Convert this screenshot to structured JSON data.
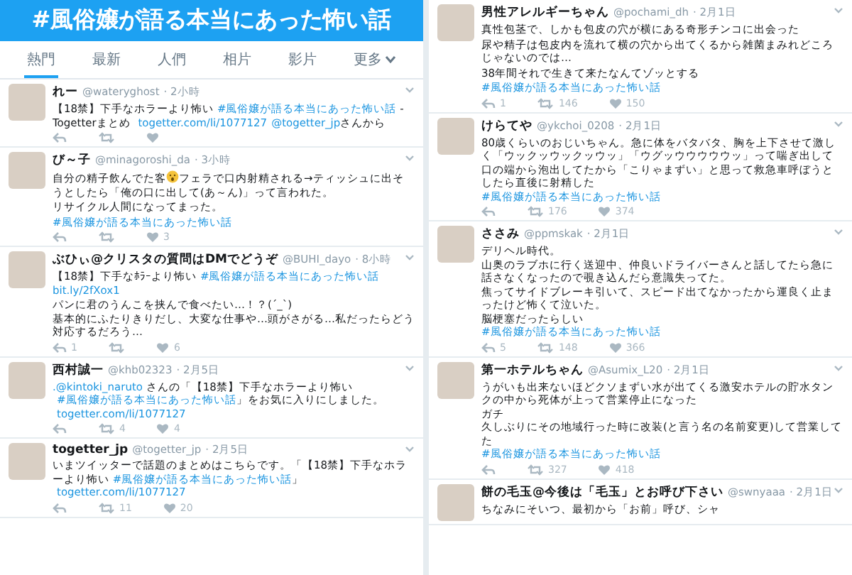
{
  "header": {
    "title": "#風俗嬢が語る本当にあった怖い話"
  },
  "tabs": [
    {
      "label": "熱門",
      "selected": true,
      "kind": "plain"
    },
    {
      "label": "最新",
      "selected": false,
      "kind": "plain"
    },
    {
      "label": "人們",
      "selected": false,
      "kind": "plain"
    },
    {
      "label": "相片",
      "selected": false,
      "kind": "plain"
    },
    {
      "label": "影片",
      "selected": false,
      "kind": "plain"
    },
    {
      "label": "更多",
      "selected": false,
      "kind": "dropdown"
    }
  ],
  "left_column": [
    {
      "name": "れー",
      "handle": "@wateryghost",
      "time": "· 2小時",
      "body": [
        [
          [
            {
              "kind": "text",
              "text": "【18禁】下手なホラーより怖い "
            },
            {
              "kind": "hashtag",
              "text": "#風俗嬢が語る本当にあった怖い話"
            },
            {
              "kind": "text",
              "text": " - Togetterまとめ "
            },
            {
              "kind": "url",
              "text": "togetter.com/li/1077127"
            },
            {
              "kind": "mention",
              "text": "@togetter_jp"
            },
            {
              "kind": "text",
              "text": "さんから"
            }
          ]
        ]
      ],
      "actions": [
        {
          "kind": "reply"
        },
        {
          "kind": "retweet"
        },
        {
          "kind": "like"
        }
      ]
    },
    {
      "name": "び～子",
      "handle": "@minagoroshi_da",
      "time": "· 3小時",
      "body": [
        [
          [
            {
              "kind": "text",
              "text": "自分の精子飲んでた客"
            },
            {
              "kind": "emoji"
            },
            {
              "kind": "text",
              "text": "フェラで口内射精される→ティッシュに出そうとしたら「俺の口に出して(あ～ん)」って言われた。"
            }
          ]
        ],
        [
          [
            {
              "kind": "text",
              "text": "リサイクル人間になってまった。"
            }
          ]
        ],
        [
          [
            {
              "kind": "hashtag",
              "text": "#風俗嬢が語る本当にあった怖い話"
            }
          ]
        ]
      ],
      "actions": [
        {
          "kind": "reply"
        },
        {
          "kind": "retweet"
        },
        {
          "kind": "like",
          "count": "3"
        }
      ]
    },
    {
      "name": "ぶひぃ@クリスタの質問はDMでどうぞ",
      "handle": "@BUHI_dayo",
      "time": "· 8小時",
      "body": [
        [
          [
            {
              "kind": "text",
              "text": "【18禁】下手なﾎﾗｰより怖い "
            },
            {
              "kind": "hashtag",
              "text": "#風俗嬢が語る本当にあった怖い話"
            }
          ],
          [
            {
              "kind": "url",
              "text": "bit.ly/2fXox1"
            }
          ]
        ],
        [
          [
            {
              "kind": "text",
              "text": "パンに君のうんこを挟んで食べたい…！？(´_`)"
            }
          ],
          [
            {
              "kind": "text",
              "text": "基本的にふたりきりだし、大変な仕事や…頭がさがる…私だったらどう対応するだろう…"
            }
          ]
        ]
      ],
      "actions": [
        {
          "kind": "reply",
          "count": "1"
        },
        {
          "kind": "retweet"
        },
        {
          "kind": "like",
          "count": "6"
        }
      ]
    },
    {
      "name": "西村誠一",
      "handle": "@khb02323",
      "time": "· 2月5日",
      "body": [
        [
          [
            {
              "kind": "mention",
              "text": ".@kintoki_naruto"
            },
            {
              "kind": "text",
              "text": " さんの「【18禁】下手なホラーより怖い "
            },
            {
              "kind": "hashtag",
              "text": "#風俗嬢が語る本当にあった怖い話"
            },
            {
              "kind": "text",
              "text": "」をお気に入りにしました。 "
            },
            {
              "kind": "url",
              "text": "togetter.com/li/1077127"
            }
          ]
        ]
      ],
      "actions": [
        {
          "kind": "reply"
        },
        {
          "kind": "retweet",
          "count": "4"
        },
        {
          "kind": "like",
          "count": "4"
        }
      ]
    },
    {
      "name": "togetter_jp",
      "handle": "@togetter_jp",
      "time": "· 2月5日",
      "body": [
        [
          [
            {
              "kind": "text",
              "text": "いまツイッターで話題のまとめはこちらです。「【18禁】下手なホラーより怖い "
            },
            {
              "kind": "hashtag",
              "text": "#風俗嬢が語る本当にあった怖い話"
            },
            {
              "kind": "text",
              "text": "」 "
            },
            {
              "kind": "url",
              "text": "togetter.com/li/1077127"
            }
          ]
        ]
      ],
      "actions": [
        {
          "kind": "reply"
        },
        {
          "kind": "retweet",
          "count": "11"
        },
        {
          "kind": "like",
          "count": "20"
        }
      ]
    }
  ],
  "right_column": [
    {
      "name": "男性アレルギーちゃん",
      "handle": "@pochami_dh",
      "time": "· 2月1日",
      "body": [
        [
          [
            {
              "kind": "text",
              "text": "真性包茎で、しかも包皮の穴が横にある奇形チンコに出会った"
            }
          ]
        ],
        [
          [
            {
              "kind": "text",
              "text": "尿や精子は包皮内を流れて横の穴から出てくるから雑菌まみれどころじゃないのでは…"
            }
          ]
        ],
        [
          [
            {
              "kind": "text",
              "text": "38年間それで生きて来たなんてゾッとする"
            }
          ]
        ],
        [
          [
            {
              "kind": "hashtag",
              "text": "#風俗嬢が語る本当にあった怖い話"
            }
          ]
        ]
      ],
      "actions": [
        {
          "kind": "reply",
          "count": "1"
        },
        {
          "kind": "retweet",
          "count": "146"
        },
        {
          "kind": "like",
          "count": "150"
        }
      ]
    },
    {
      "name": "けらてや",
      "handle": "@ykchoi_0208",
      "time": "· 2月1日",
      "body": [
        [
          [
            {
              "kind": "text",
              "text": "80歳くらいのおじいちゃん。急に体をバタバタ、胸を上下させて激しく「ウックッウックッウッ」「ウグッウウウウウッ」って喘ぎ出して口の端から泡出してたから「こりゃまずい」と思って救急車呼ぼうとしたら直後に射精した"
            }
          ],
          [
            {
              "kind": "hashtag",
              "text": "#風俗嬢が語る本当にあった怖い話"
            }
          ]
        ]
      ],
      "actions": [
        {
          "kind": "reply"
        },
        {
          "kind": "retweet",
          "count": "176"
        },
        {
          "kind": "like",
          "count": "374"
        }
      ]
    },
    {
      "name": "ささみ",
      "handle": "@ppmskak",
      "time": "· 2月1日",
      "body": [
        [
          [
            {
              "kind": "text",
              "text": "デリヘル時代。"
            }
          ],
          [
            {
              "kind": "text",
              "text": "山奥のラブホに行く送迎中、仲良いドライバーさんと話してたら急に話さなくなったので覗き込んだら意識失ってた。"
            }
          ],
          [
            {
              "kind": "text",
              "text": "焦ってサイドブレーキ引いて、スピード出てなかったから運良く止まったけど怖くて泣いた。"
            }
          ],
          [
            {
              "kind": "text",
              "text": "脳梗塞だったらしい"
            }
          ],
          [
            {
              "kind": "hashtag",
              "text": "#風俗嬢が語る本当にあった怖い話"
            }
          ]
        ]
      ],
      "actions": [
        {
          "kind": "reply",
          "count": "5"
        },
        {
          "kind": "retweet",
          "count": "148"
        },
        {
          "kind": "like",
          "count": "366"
        }
      ]
    },
    {
      "name": "第一ホテルちゃん",
      "handle": "@Asumix_L20",
      "time": "· 2月1日",
      "body": [
        [
          [
            {
              "kind": "text",
              "text": "うがいも出来ないほどクソまずい水が出てくる激安ホテルの貯水タンクの中から死体が上って営業停止になった"
            }
          ],
          [
            {
              "kind": "text",
              "text": "ガチ"
            }
          ],
          [
            {
              "kind": "text",
              "text": "久しぶりにその地域行った時に改装(と言う名の名前変更)して営業してた"
            }
          ],
          [
            {
              "kind": "hashtag",
              "text": "#風俗嬢が語る本当にあった怖い話"
            }
          ]
        ]
      ],
      "actions": [
        {
          "kind": "reply"
        },
        {
          "kind": "retweet",
          "count": "327"
        },
        {
          "kind": "like",
          "count": "418"
        }
      ]
    },
    {
      "name": "餅の毛玉@今後は「毛玉」とお呼び下さい",
      "handle": "@swnyaaa",
      "time": "· 2月1日",
      "body": [
        [
          [
            {
              "kind": "text",
              "text": "ちなみにそいつ、最初から「お前」呼び、シャ"
            }
          ]
        ]
      ]
    }
  ]
}
